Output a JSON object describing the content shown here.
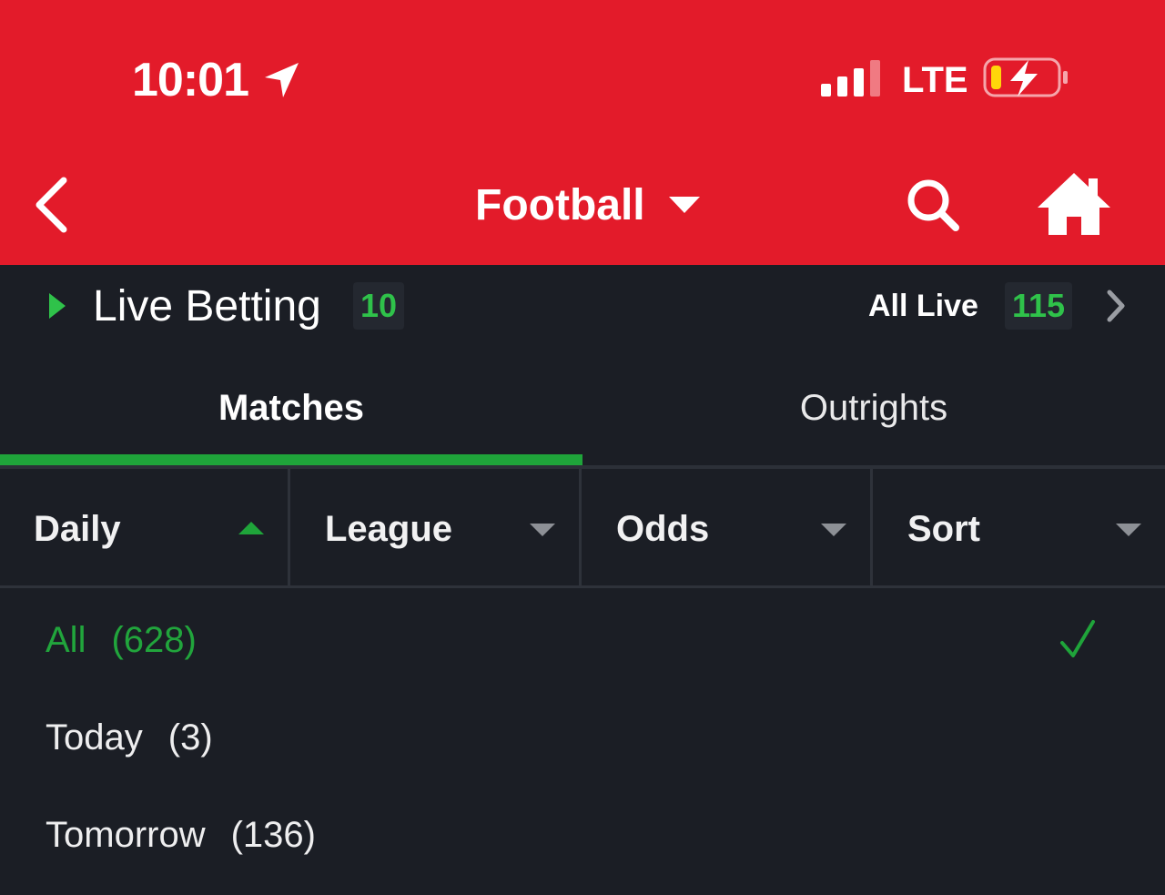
{
  "status_bar": {
    "time": "10:01",
    "network": "LTE",
    "icons": [
      "location-arrow-icon",
      "signal-bars-icon",
      "battery-charging-icon"
    ]
  },
  "header": {
    "title": "Football",
    "icons": [
      "back-chevron-icon",
      "dropdown-caret-icon",
      "search-icon",
      "home-icon"
    ]
  },
  "live_betting": {
    "label": "Live Betting",
    "count": "10",
    "all_live_label": "All Live",
    "all_live_count": "115"
  },
  "tabs": [
    {
      "label": "Matches",
      "active": true
    },
    {
      "label": "Outrights",
      "active": false
    }
  ],
  "filters": [
    {
      "label": "Daily",
      "expanded": true
    },
    {
      "label": "League",
      "expanded": false
    },
    {
      "label": "Odds",
      "expanded": false
    },
    {
      "label": "Sort",
      "expanded": false
    }
  ],
  "daily_options": [
    {
      "label": "All",
      "count": "(628)",
      "selected": true
    },
    {
      "label": "Today",
      "count": "(3)",
      "selected": false
    },
    {
      "label": "Tomorrow",
      "count": "(136)",
      "selected": false
    }
  ],
  "colors": {
    "header_red": "#e31b2a",
    "background": "#1b1e25",
    "accent_green": "#1fa43a",
    "count_green": "#2fc24a",
    "battery_yellow": "#ffd60a"
  }
}
